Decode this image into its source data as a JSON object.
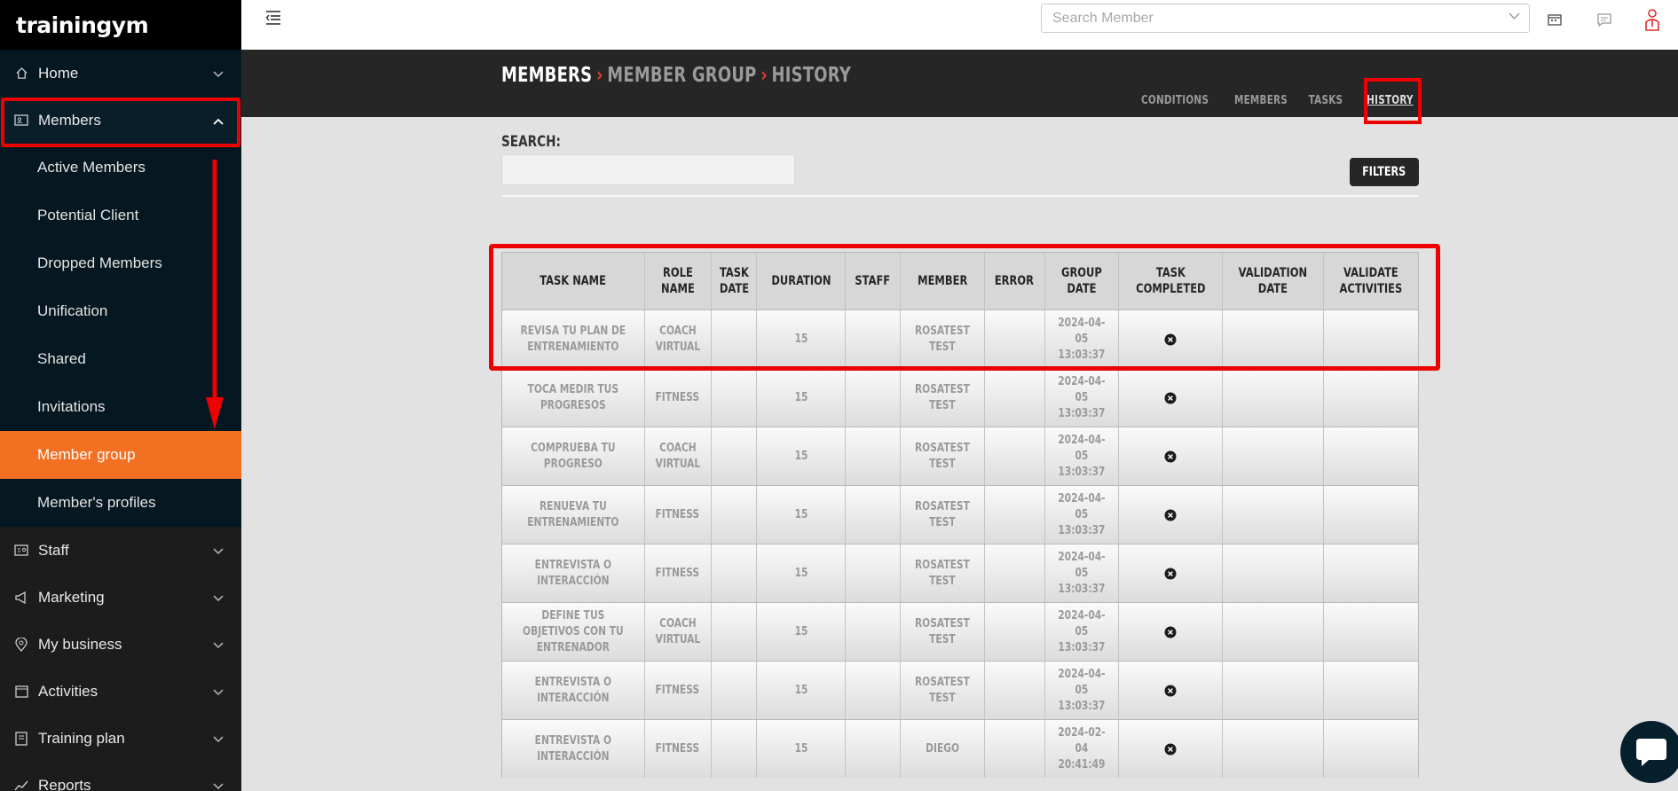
{
  "brand": {
    "logo_text": "trainingym"
  },
  "sidebar": {
    "items": [
      {
        "label": "Home",
        "icon": "home-icon"
      },
      {
        "label": "Members",
        "icon": "id-card-icon",
        "expanded": true
      }
    ],
    "members_submenu": [
      "Active Members",
      "Potential Client",
      "Dropped Members",
      "Unification",
      "Shared",
      "Invitations",
      "Member group",
      "Member's profiles"
    ],
    "active_submenu": "Member group",
    "bottom_items": [
      {
        "label": "Staff",
        "icon": "staff-card-icon"
      },
      {
        "label": "Marketing",
        "icon": "megaphone-icon"
      },
      {
        "label": "My business",
        "icon": "location-pin-icon"
      },
      {
        "label": "Activities",
        "icon": "calendar-icon"
      },
      {
        "label": "Training plan",
        "icon": "clipboard-icon"
      },
      {
        "label": "Reports",
        "icon": "chart-line-icon"
      }
    ]
  },
  "topbar": {
    "search_placeholder": "Search Member",
    "icons": [
      "calendar-icon",
      "chat-icon",
      "user-alert-icon"
    ]
  },
  "header": {
    "breadcrumb": [
      "MEMBERS",
      "MEMBER GROUP",
      "HISTORY"
    ],
    "tabs": [
      "CONDITIONS",
      "MEMBERS",
      "TASKS",
      "HISTORY"
    ],
    "active_tab": "HISTORY"
  },
  "search": {
    "label": "SEARCH:",
    "value": ""
  },
  "filters_button": "FILTERS",
  "table": {
    "columns": [
      "TASK NAME",
      "ROLE NAME",
      "TASK DATE",
      "DURATION",
      "STAFF",
      "MEMBER",
      "ERROR",
      "GROUP DATE",
      "TASK COMPLETED",
      "VALIDATION DATE",
      "VALIDATE ACTIVITIES"
    ],
    "rows": [
      [
        "REVISA TU PLAN DE ENTRENAMIENTO",
        "COACH VIRTUAL",
        "",
        "15",
        "",
        "ROSATEST TEST",
        "",
        "2024-04-05 13:03:37",
        "x",
        "",
        ""
      ],
      [
        "TOCA MEDIR TUS PROGRESOS",
        "FITNESS",
        "",
        "15",
        "",
        "ROSATEST TEST",
        "",
        "2024-04-05 13:03:37",
        "x",
        "",
        ""
      ],
      [
        "COMPRUEBA TU PROGRESO",
        "COACH VIRTUAL",
        "",
        "15",
        "",
        "ROSATEST TEST",
        "",
        "2024-04-05 13:03:37",
        "x",
        "",
        ""
      ],
      [
        "RENUEVA TU ENTRENAMIENTO",
        "FITNESS",
        "",
        "15",
        "",
        "ROSATEST TEST",
        "",
        "2024-04-05 13:03:37",
        "x",
        "",
        ""
      ],
      [
        "ENTREVISTA O INTERACCIÓN",
        "FITNESS",
        "",
        "15",
        "",
        "ROSATEST TEST",
        "",
        "2024-04-05 13:03:37",
        "x",
        "",
        ""
      ],
      [
        "DEFINE TUS OBJETIVOS CON TU ENTRENADOR",
        "COACH VIRTUAL",
        "",
        "15",
        "",
        "ROSATEST TEST",
        "",
        "2024-04-05 13:03:37",
        "x",
        "",
        ""
      ],
      [
        "ENTREVISTA O INTERACCIÓN",
        "FITNESS",
        "",
        "15",
        "",
        "ROSATEST TEST",
        "",
        "2024-04-05 13:03:37",
        "x",
        "",
        ""
      ],
      [
        "ENTREVISTA O INTERACCIÓN",
        "FITNESS",
        "",
        "15",
        "",
        "DIEGO",
        "",
        "2024-02-04 20:41:49",
        "x",
        "",
        ""
      ]
    ]
  },
  "colors": {
    "accent": "#f36f21",
    "sidebar_bg": "#051720",
    "highlight": "#ee0000",
    "header_bg": "#262626"
  }
}
